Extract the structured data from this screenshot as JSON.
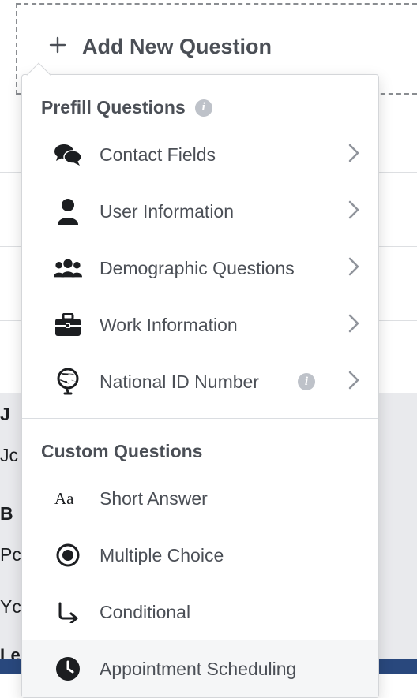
{
  "header": {
    "add_new_question": "Add New Question"
  },
  "sections": {
    "prefill": {
      "title": "Prefill Questions",
      "items": [
        {
          "label": "Contact Fields"
        },
        {
          "label": "User Information"
        },
        {
          "label": "Demographic Questions"
        },
        {
          "label": "Work Information"
        },
        {
          "label": "National ID Number"
        }
      ]
    },
    "custom": {
      "title": "Custom Questions",
      "items": [
        {
          "label": "Short Answer"
        },
        {
          "label": "Multiple Choice"
        },
        {
          "label": "Conditional"
        },
        {
          "label": "Appointment Scheduling"
        }
      ]
    }
  },
  "background": {
    "jo": "J",
    "jo2": "Jc",
    "br": "B",
    "pc": "Pc",
    "yc": "Yc",
    "lead": "Lead Ads For"
  }
}
